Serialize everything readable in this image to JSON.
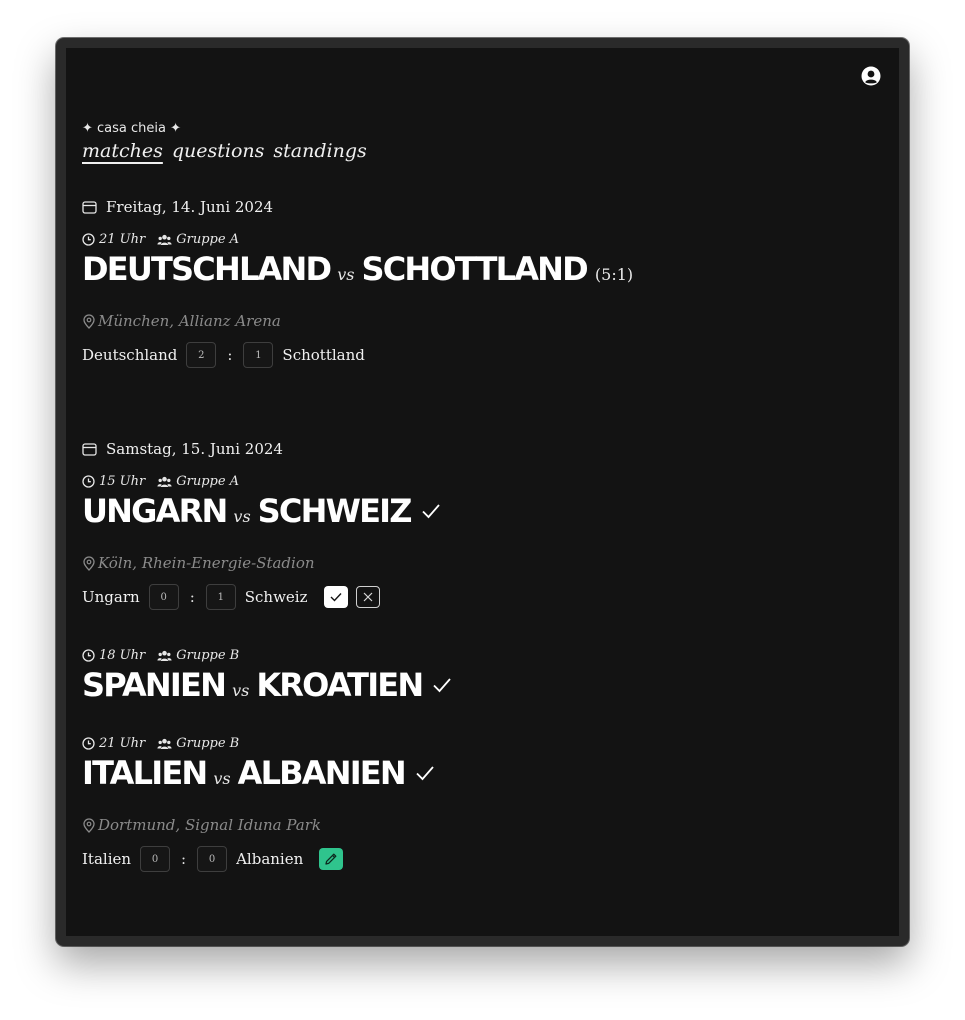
{
  "app": {
    "brand": "✦ casa cheia ✦"
  },
  "nav": {
    "matches": "matches",
    "questions": "questions",
    "standings": "standings"
  },
  "days": [
    {
      "date": "Freitag, 14. Juni 2024"
    },
    {
      "date": "Samstag, 15. Juni 2024"
    }
  ],
  "matches": [
    {
      "time": "21 Uhr",
      "group": "Gruppe A",
      "home": "DEUTSCHLAND",
      "vs": "vs",
      "away": "SCHOTTLAND",
      "result": "(5:1)",
      "venue": "München, Allianz Arena",
      "home_label": "Deutschland",
      "away_label": "Schottland",
      "home_bet": "2",
      "away_bet": "1",
      "colon": ":"
    },
    {
      "time": "15 Uhr",
      "group": "Gruppe A",
      "home": "UNGARN",
      "vs": "vs",
      "away": "SCHWEIZ",
      "venue": "Köln, Rhein-Energie-Stadion",
      "home_label": "Ungarn",
      "away_label": "Schweiz",
      "home_bet": "0",
      "away_bet": "1",
      "colon": ":"
    },
    {
      "time": "18 Uhr",
      "group": "Gruppe B",
      "home": "SPANIEN",
      "vs": "vs",
      "away": "KROATIEN"
    },
    {
      "time": "21 Uhr",
      "group": "Gruppe B",
      "home": "ITALIEN",
      "vs": "vs",
      "away": "ALBANIEN",
      "venue": "Dortmund, Signal Iduna Park",
      "home_label": "Italien",
      "away_label": "Albanien",
      "home_bet": "0",
      "away_bet": "0",
      "colon": ":"
    }
  ],
  "icons": {
    "avatar": "user-circle-icon",
    "calendar": "calendar-icon",
    "clock": "clock-icon",
    "group": "users-icon",
    "pin": "map-pin-icon",
    "check": "check-icon",
    "close": "close-icon",
    "edit": "pencil-icon"
  },
  "colors": {
    "background": "#131313",
    "text": "#f2f2f2",
    "muted": "#8a8a8a",
    "accent": "#2fc48d"
  }
}
